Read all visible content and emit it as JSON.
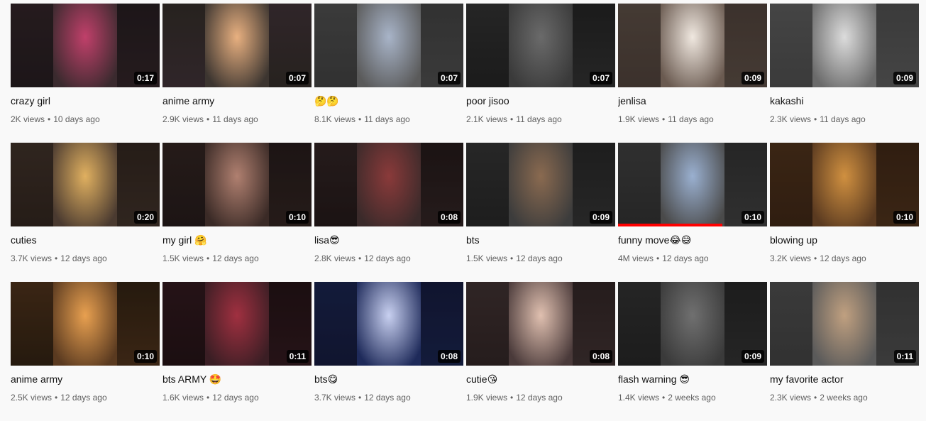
{
  "colors": {
    "background": "#f9f9f9",
    "title": "#0f0f0f",
    "meta": "#606060",
    "progress": "#ff0000",
    "duration_bg": "#000000"
  },
  "separator": "•",
  "videos": [
    {
      "title": "crazy girl",
      "views": "2K views",
      "age": "10 days ago",
      "duration": "0:17",
      "palette": [
        "#3a2a2e",
        "#c0406a",
        "#2c2226"
      ]
    },
    {
      "title": "anime army",
      "views": "2.9K views",
      "age": "11 days ago",
      "duration": "0:07",
      "palette": [
        "#3c3530",
        "#e8b080",
        "#4a3a40"
      ]
    },
    {
      "title": "🤔🤔",
      "views": "8.1K views",
      "age": "11 days ago",
      "duration": "0:07",
      "palette": [
        "#5a5a5a",
        "#a8b4c8",
        "#4c4c4c"
      ]
    },
    {
      "title": "poor jisoo",
      "views": "2.1K views",
      "age": "11 days ago",
      "duration": "0:07",
      "palette": [
        "#3a3a3a",
        "#6a6a6a",
        "#2a2a2a"
      ]
    },
    {
      "title": "jenlisa",
      "views": "1.9K views",
      "age": "11 days ago",
      "duration": "0:09",
      "palette": [
        "#6a5a50",
        "#f0e8e0",
        "#5c4c44"
      ]
    },
    {
      "title": "kakashi",
      "views": "2.3K views",
      "age": "11 days ago",
      "duration": "0:09",
      "palette": [
        "#6a6a6a",
        "#dcdcdc",
        "#5a5a5a"
      ]
    },
    {
      "title": "cuties",
      "views": "3.7K views",
      "age": "12 days ago",
      "duration": "0:20",
      "palette": [
        "#4a3a30",
        "#e0b060",
        "#3a2c24"
      ]
    },
    {
      "title": "my girl 🤗",
      "views": "1.5K views",
      "age": "12 days ago",
      "duration": "0:10",
      "palette": [
        "#3a2a26",
        "#b08070",
        "#2c2020"
      ]
    },
    {
      "title": "lisa😎",
      "views": "2.8K views",
      "age": "12 days ago",
      "duration": "0:08",
      "palette": [
        "#3a2a2a",
        "#8a3a3a",
        "#2a1e1e"
      ]
    },
    {
      "title": "bts",
      "views": "1.5K views",
      "age": "12 days ago",
      "duration": "0:09",
      "palette": [
        "#3c3c3c",
        "#8a6a50",
        "#2e2e2e"
      ]
    },
    {
      "title": "funny move😂😅",
      "views": "4M views",
      "age": "12 days ago",
      "duration": "0:10",
      "progress": 0.7,
      "palette": [
        "#4a4a4a",
        "#9ab0d0",
        "#3a3a3a"
      ]
    },
    {
      "title": "blowing up",
      "views": "3.2K views",
      "age": "12 days ago",
      "duration": "0:10",
      "palette": [
        "#5a3a20",
        "#d09040",
        "#4a2e1a"
      ]
    },
    {
      "title": "anime army",
      "views": "2.5K views",
      "age": "12 days ago",
      "duration": "0:10",
      "palette": [
        "#5a3a20",
        "#e8a050",
        "#3a2816"
      ]
    },
    {
      "title": "bts ARMY 🤩",
      "views": "1.6K views",
      "age": "12 days ago",
      "duration": "0:11",
      "palette": [
        "#3a1e24",
        "#a03040",
        "#2a161a"
      ]
    },
    {
      "title": "bts😋",
      "views": "3.7K views",
      "age": "12 days ago",
      "duration": "0:08",
      "palette": [
        "#1e2a5a",
        "#c8d0f0",
        "#1a2048"
      ]
    },
    {
      "title": "cutie😘",
      "views": "1.9K views",
      "age": "12 days ago",
      "duration": "0:08",
      "palette": [
        "#4a3a3a",
        "#e0c0b0",
        "#3a2c2c"
      ]
    },
    {
      "title": "flash warning 😎",
      "views": "1.4K views",
      "age": "2 weeks ago",
      "duration": "0:09",
      "palette": [
        "#3a3a3a",
        "#707070",
        "#2c2c2c"
      ]
    },
    {
      "title": "my favorite actor",
      "views": "2.3K views",
      "age": "2 weeks ago",
      "duration": "0:11",
      "palette": [
        "#5a5a5a",
        "#c0a080",
        "#4c4c4c"
      ]
    }
  ]
}
